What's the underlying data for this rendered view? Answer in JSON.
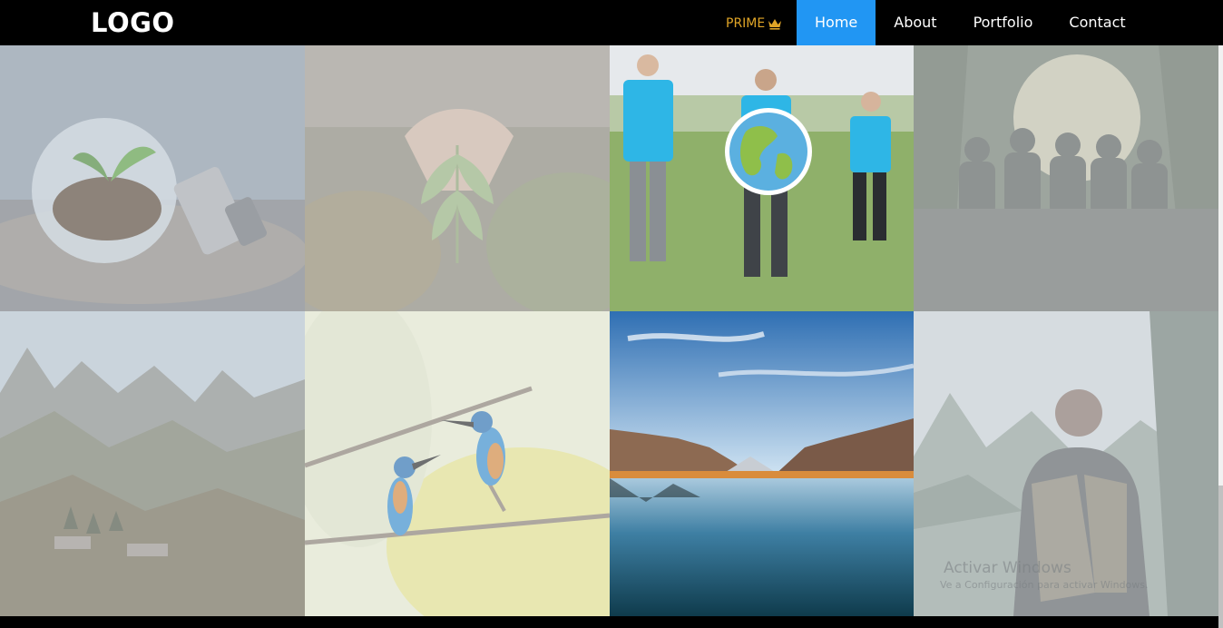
{
  "navbar": {
    "logo": "LOGO",
    "prime_label": "PRIME",
    "prime_icon": "crown-icon",
    "links": [
      {
        "label": "Home",
        "active": true
      },
      {
        "label": "About",
        "active": false
      },
      {
        "label": "Portfolio",
        "active": false
      },
      {
        "label": "Contact",
        "active": false
      }
    ]
  },
  "gallery": {
    "tiles": [
      {
        "subject": "lightbulb-plant-image"
      },
      {
        "subject": "hands-fern-image"
      },
      {
        "subject": "volunteers-globe-image"
      },
      {
        "subject": "forest-people-image"
      },
      {
        "subject": "mountains-image"
      },
      {
        "subject": "kingfishers-image"
      },
      {
        "subject": "lake-image"
      },
      {
        "subject": "hiker-image"
      }
    ]
  },
  "watermark": {
    "title": "Activar Windows",
    "subtitle": "Ve a Configuración para activar Windows."
  },
  "colors": {
    "accent": "#2196f3",
    "prime": "#e0a527",
    "navbar_bg": "#000000"
  }
}
